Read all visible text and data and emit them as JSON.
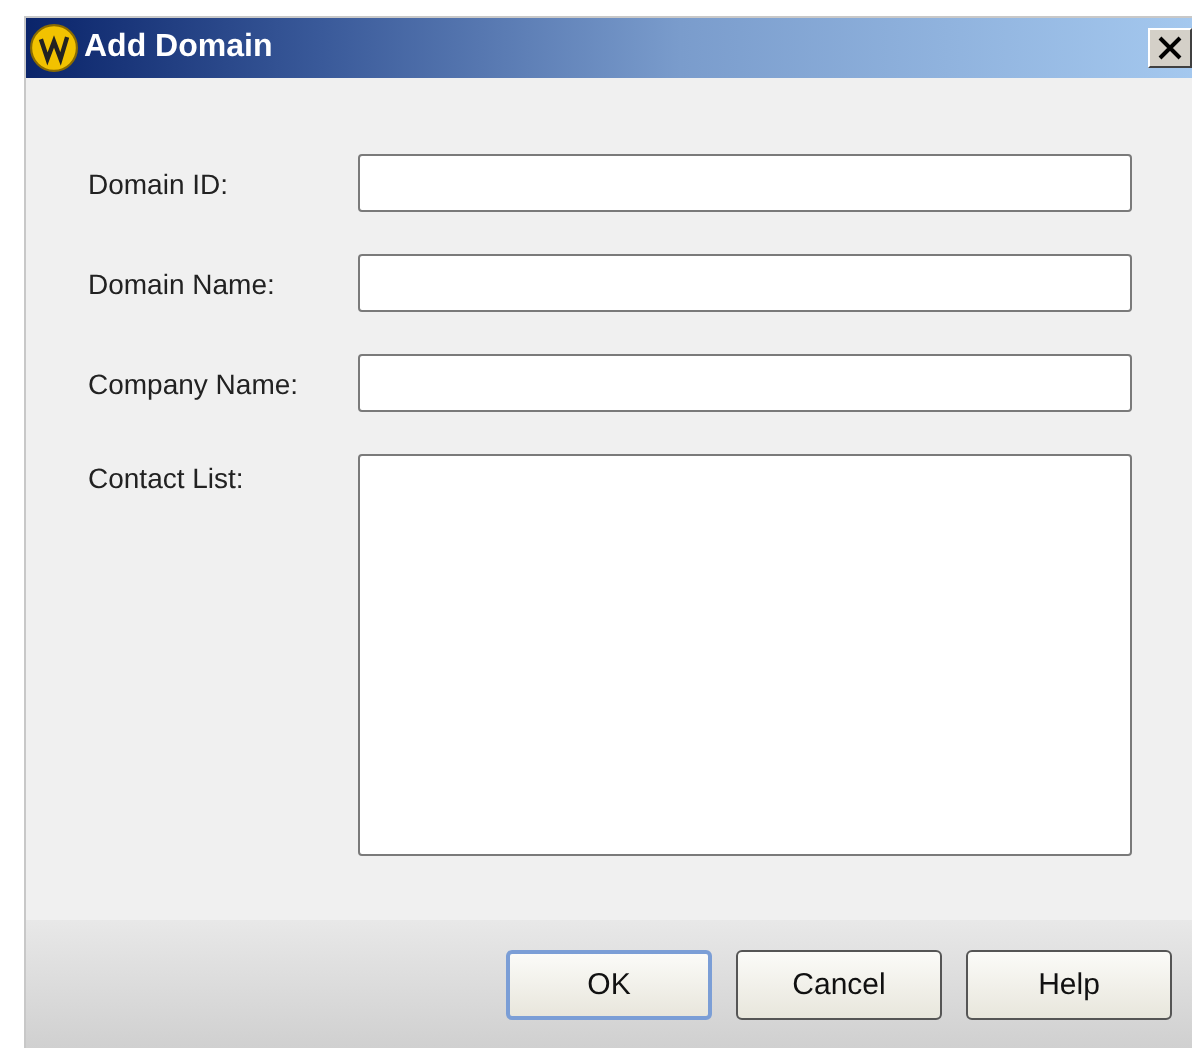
{
  "window": {
    "title": "Add Domain"
  },
  "fields": [
    {
      "label": "Domain ID:",
      "kind": "line"
    },
    {
      "label": "Domain Name:",
      "kind": "line"
    },
    {
      "label": "Company Name:",
      "kind": "line"
    },
    {
      "label": "Contact List:",
      "kind": "area"
    }
  ],
  "buttons": [
    {
      "label": "OK",
      "default": true
    },
    {
      "label": "Cancel",
      "default": false
    },
    {
      "label": "Help",
      "default": false
    }
  ]
}
